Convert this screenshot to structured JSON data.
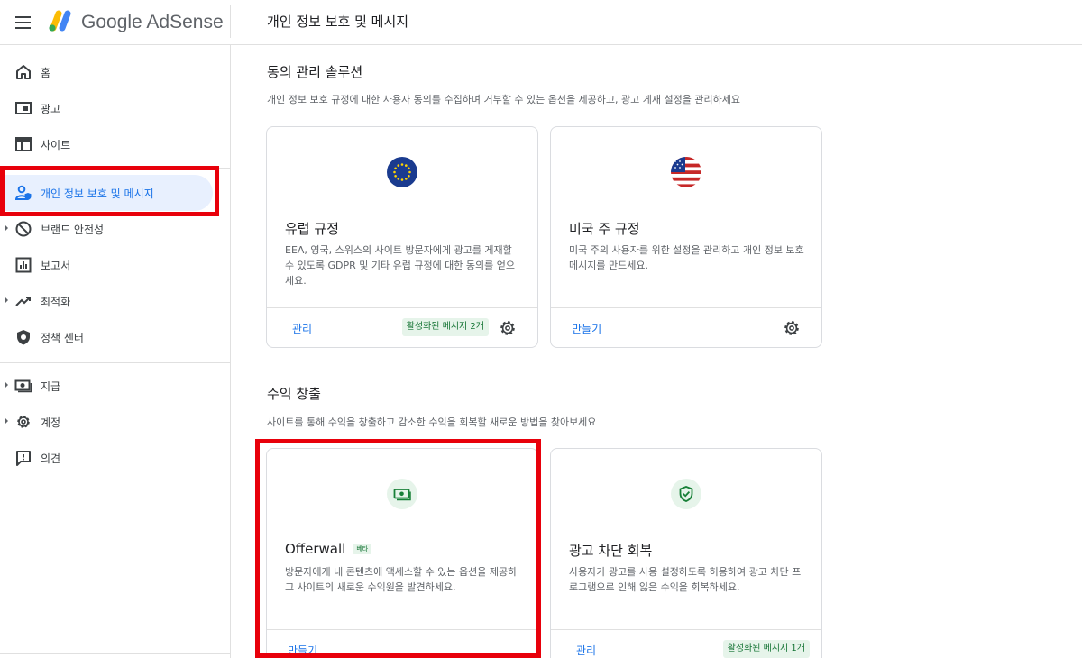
{
  "header": {
    "brand": "Google AdSense",
    "page_title": "개인 정보 보호 및 메시지"
  },
  "sidebar": {
    "items": [
      {
        "label": "홈",
        "icon": "home-icon"
      },
      {
        "label": "광고",
        "icon": "ads-icon"
      },
      {
        "label": "사이트",
        "icon": "sites-icon"
      },
      {
        "label": "개인 정보 보호 및 메시지",
        "icon": "privacy-person-icon",
        "active": true
      },
      {
        "label": "브랜드 안전성",
        "icon": "block-icon",
        "expandable": true
      },
      {
        "label": "보고서",
        "icon": "reports-icon"
      },
      {
        "label": "최적화",
        "icon": "trending-up-icon",
        "expandable": true
      },
      {
        "label": "정책 센터",
        "icon": "shield-icon"
      },
      {
        "label": "지급",
        "icon": "payments-icon",
        "expandable": true
      },
      {
        "label": "계정",
        "icon": "gear-icon",
        "expandable": true
      },
      {
        "label": "의견",
        "icon": "feedback-icon"
      }
    ]
  },
  "consent": {
    "title": "동의 관리 솔루션",
    "desc": "개인 정보 보호 규정에 대한 사용자 동의를 수집하며 거부할 수 있는 옵션을 제공하고, 광고 게재 설정을 관리하세요",
    "cards": [
      {
        "title": "유럽 규정",
        "desc": "EEA, 영국, 스위스의 사이트 방문자에게 광고를 게재할 수 있도록 GDPR 및 기타 유럽 규정에 대한 동의를 얻으세요.",
        "link": "관리",
        "status": "활성화된 메시지 2개",
        "icon": "eu-flag-icon"
      },
      {
        "title": "미국 주 규정",
        "desc": "미국 주의 사용자를 위한 설정을 관리하고 개인 정보 보호 메시지를 만드세요.",
        "link": "만들기",
        "icon": "us-flag-icon"
      }
    ]
  },
  "revenue": {
    "title": "수익 창출",
    "desc": "사이트를 통해 수익을 창출하고 감소한 수익을 회복할 새로운 방법을 찾아보세요",
    "cards": [
      {
        "title": "Offerwall",
        "badge": "베타",
        "desc": "방문자에게 내 콘텐츠에 액세스할 수 있는 옵션을 제공하고 사이트의 새로운 수익원을 발견하세요.",
        "link": "만들기",
        "icon": "money-icon"
      },
      {
        "title": "광고 차단 회복",
        "desc": "사용자가 광고를 사용 설정하도록 허용하여 광고 차단 프로그램으로 인해 잃은 수익을 회복하세요.",
        "link": "관리",
        "status": "활성화된 메시지 1개",
        "icon": "shield-check-icon"
      }
    ]
  },
  "colors": {
    "accent": "#1a73e8",
    "highlight": "#e8000b",
    "chip_bg": "#e6f4ea",
    "chip_text": "#137333"
  }
}
